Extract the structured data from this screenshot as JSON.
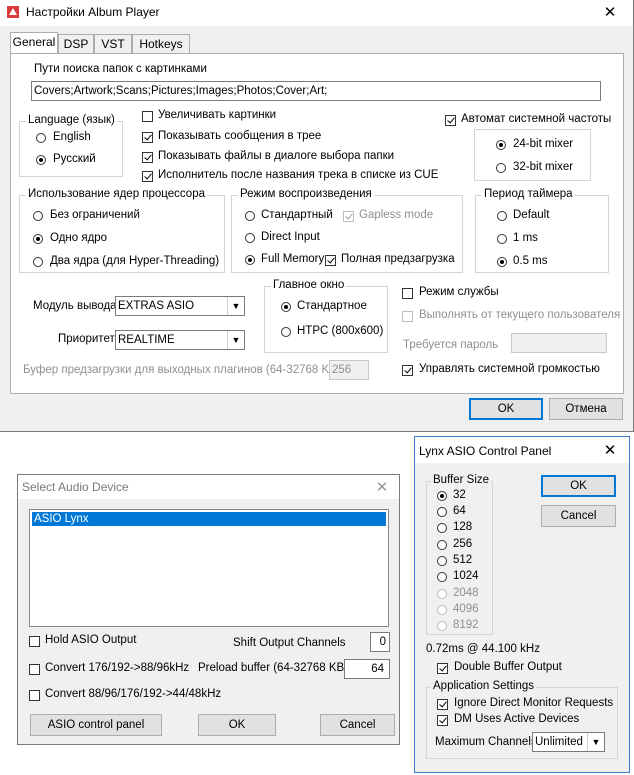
{
  "settings": {
    "title": "Настройки Album Player",
    "close": "✕",
    "tabs": [
      "General",
      "DSP",
      "VST",
      "Hotkeys"
    ],
    "paths_label": "Пути поиска папок с картинками",
    "paths_value": "Covers;Artwork;Scans;Pictures;Images;Photos;Cover;Art;",
    "language": {
      "title": "Language (язык)",
      "english": "English",
      "russian": "Русский"
    },
    "checks": {
      "enlarge": "Увеличивать картинки",
      "tree_msgs": "Показывать сообщения в трее",
      "show_files": "Показывать файлы в диалоге выбора папки",
      "artist_after": "Исполнитель после названия трека в списке из CUE",
      "auto_freq": "Автомат системной частоты"
    },
    "mixer": {
      "bit24": "24-bit mixer",
      "bit32": "32-bit mixer"
    },
    "cores": {
      "title": "Использование ядер процессора",
      "unlimited": "Без ограничений",
      "one": "Одно ядро",
      "two": "Два ядра (для Hyper-Threading)"
    },
    "playback": {
      "title": "Режим воспроизведения",
      "standard": "Стандартный",
      "gapless": "Gapless mode",
      "direct": "Direct Input",
      "full_memory": "Full Memory",
      "full_preload": "Полная предзагрузка"
    },
    "timer": {
      "title": "Период таймера",
      "default": "Default",
      "ms1": "1 ms",
      "ms05": "0.5 ms"
    },
    "output_label": "Модуль вывода",
    "output_value": "EXTRAS ASIO",
    "priority_label": "Приоритет",
    "priority_value": "REALTIME",
    "main_window": {
      "title": "Главное окно",
      "standard": "Стандартное",
      "htpc": "HTPC (800x600)"
    },
    "service_mode": "Режим службы",
    "run_as_user": "Выполнять от текущего пользователя",
    "password_label": "Требуется пароль",
    "buffer_label": "Буфер предзагрузки для выходных плагинов (64-32768 KB)",
    "buffer_value": "256",
    "control_volume": "Управлять системной громкостью",
    "ok": "OK",
    "cancel": "Отмена"
  },
  "audio_device": {
    "title": "Select Audio Device",
    "close": "✕",
    "devices": [
      "ASIO Lynx"
    ],
    "hold_output": "Hold ASIO Output",
    "shift_label": "Shift Output Channels",
    "shift_value": "0",
    "convert176": "Convert 176/192->88/96kHz",
    "preload_label": "Preload buffer (64-32768 KB)",
    "preload_value": "64",
    "convert88": "Convert 88/96/176/192->44/48kHz",
    "asio_panel": "ASIO control panel",
    "ok": "OK",
    "cancel": "Cancel"
  },
  "lynx": {
    "title": "Lynx ASIO Control Panel",
    "close": "✕",
    "buffer_title": "Buffer Size",
    "sizes": [
      "32",
      "64",
      "128",
      "256",
      "512",
      "1024",
      "2048",
      "4096",
      "8192"
    ],
    "latency": "0.72ms @ 44.100 kHz",
    "double_buffer": "Double Buffer Output",
    "app_title": "Application Settings",
    "ignore_direct": "Ignore Direct Monitor Requests",
    "dm_active": "DM Uses Active Devices",
    "max_channels_label": "Maximum Channels:",
    "max_channels_value": "Unlimited",
    "ok": "OK",
    "cancel": "Cancel"
  }
}
